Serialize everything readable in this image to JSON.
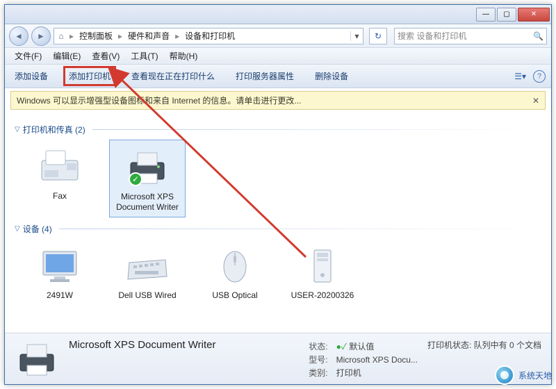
{
  "title_buttons": {
    "min": "—",
    "max": "▢",
    "close": "✕"
  },
  "breadcrumb": {
    "home_icon": "⌂",
    "items": [
      "控制面板",
      "硬件和声音",
      "设备和打印机"
    ]
  },
  "refresh_icon": "↻",
  "search": {
    "placeholder": "搜索 设备和打印机",
    "icon": "🔍"
  },
  "menu": [
    "文件(F)",
    "编辑(E)",
    "查看(V)",
    "工具(T)",
    "帮助(H)"
  ],
  "toolbar": {
    "items": [
      "添加设备",
      "添加打印机",
      "查看现在正在打印什么",
      "打印服务器属性",
      "删除设备"
    ],
    "highlight_index": 1,
    "help": "?"
  },
  "infobar": {
    "text": "Windows 可以显示增强型设备图标和来自 Internet 的信息。请单击进行更改...",
    "close": "✕"
  },
  "groups": [
    {
      "title": "打印机和传真 (2)",
      "items": [
        {
          "name": "Fax",
          "icon": "fax"
        },
        {
          "name": "Microsoft XPS Document Writer",
          "icon": "printer",
          "selected": true,
          "default": true
        }
      ]
    },
    {
      "title": "设备 (4)",
      "items": [
        {
          "name": "2491W",
          "icon": "monitor"
        },
        {
          "name": "Dell USB Wired",
          "icon": "keyboard"
        },
        {
          "name": "USB Optical",
          "icon": "mouse"
        },
        {
          "name": "USER-20200326",
          "icon": "tower"
        }
      ]
    }
  ],
  "details": {
    "name": "Microsoft XPS Document Writer",
    "rows": [
      {
        "k": "状态:",
        "v": "默认值",
        "check": true
      },
      {
        "k": "型号:",
        "v": "Microsoft XPS Docu..."
      },
      {
        "k": "类别:",
        "v": "打印机"
      }
    ],
    "queue_label": "打印机状态:",
    "queue_value": "队列中有 0 个文档"
  },
  "watermark": "系统天地"
}
